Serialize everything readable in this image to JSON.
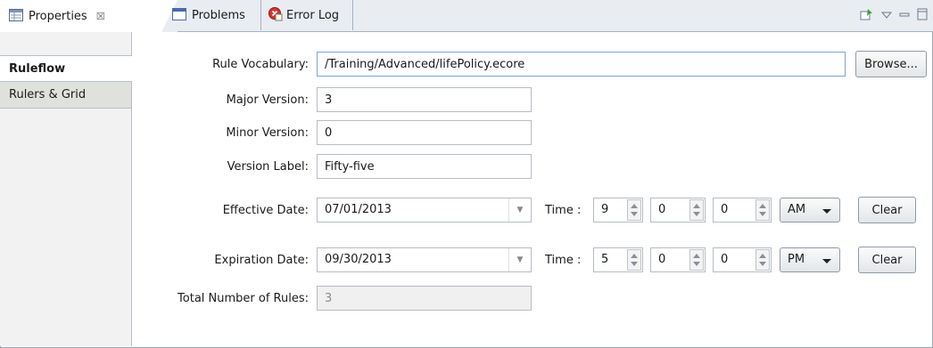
{
  "tabs": [
    {
      "label": "Properties",
      "close": "☒",
      "icon": "properties-icon"
    },
    {
      "label": "Problems",
      "icon": "problems-icon"
    },
    {
      "label": "Error Log",
      "icon": "error-log-icon"
    }
  ],
  "toolbar": {
    "pin": "pin-icon",
    "menu": "view-menu-icon",
    "minimize": "minimize-icon",
    "maximize": "maximize-icon"
  },
  "sidebar": {
    "items": [
      {
        "label": "Ruleflow",
        "selected": true
      },
      {
        "label": "Rulers & Grid",
        "selected": false
      }
    ]
  },
  "form": {
    "vocabulary_label": "Rule Vocabulary:",
    "vocabulary_value": "/Training/Advanced/lifePolicy.ecore",
    "browse_label": "Browse...",
    "major_label": "Major Version:",
    "major_value": "3",
    "minor_label": "Minor Version:",
    "minor_value": "0",
    "version_label_label": "Version Label:",
    "version_label_value": "Fifty-five",
    "effective_label": "Effective Date:",
    "effective_date": "07/01/2013",
    "effective_time": {
      "label": "Time :",
      "hour": "9",
      "minute": "0",
      "second": "0",
      "ampm": "AM",
      "clear": "Clear"
    },
    "expiration_label": "Expiration Date:",
    "expiration_date": "09/30/2013",
    "expiration_time": {
      "label": "Time :",
      "hour": "5",
      "minute": "0",
      "second": "0",
      "ampm": "PM",
      "clear": "Clear"
    },
    "total_rules_label": "Total Number of Rules:",
    "total_rules_value": "3"
  }
}
